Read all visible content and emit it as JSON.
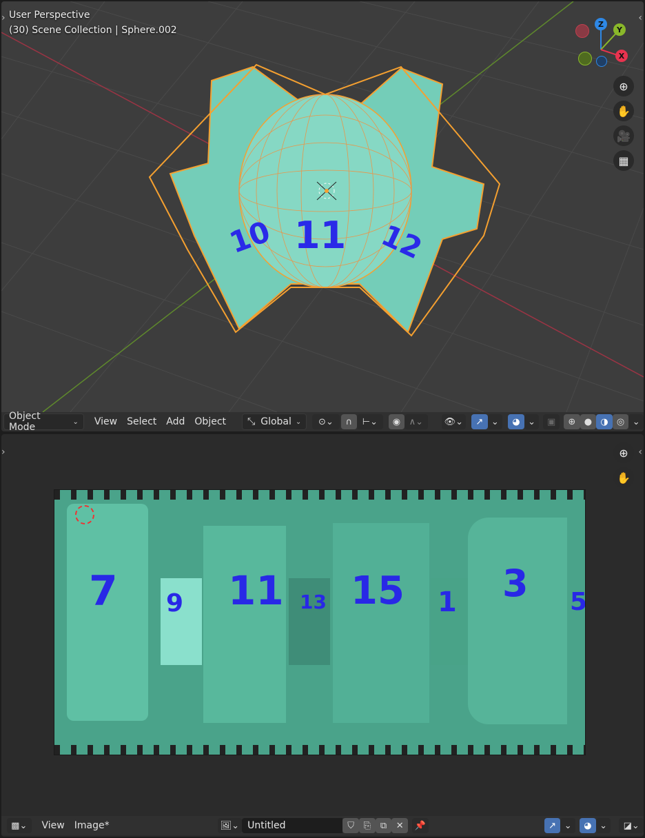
{
  "viewport": {
    "perspective_label": "User Perspective",
    "collection_label": "(30) Scene Collection | Sphere.002",
    "gizmo": {
      "x": "X",
      "y": "Y",
      "z": "Z",
      "x_color": "#e8334f",
      "y_color": "#8ab82a",
      "z_color": "#2e88e6"
    },
    "nav_icons": [
      "zoom-icon",
      "hand-pan-icon",
      "camera-icon",
      "grid-ortho-icon"
    ],
    "header": {
      "mode": "Object Mode",
      "menus": [
        "View",
        "Select",
        "Add",
        "Object"
      ],
      "orientation": "Global"
    }
  },
  "image_editor": {
    "header": {
      "menus": [
        "View",
        "Image*"
      ],
      "image_name": "Untitled"
    },
    "nav_icons": [
      "zoom-icon",
      "hand-pan-icon"
    ],
    "texture_numbers": [
      "7",
      "9",
      "11",
      "13",
      "15",
      "1",
      "3",
      "5"
    ]
  },
  "colors": {
    "accent": "#4772b3",
    "selection_outline": "#f5a030",
    "mesh": "#74cdb8",
    "texture_bg": "#4aa38a",
    "number_ink": "#2828e6"
  }
}
